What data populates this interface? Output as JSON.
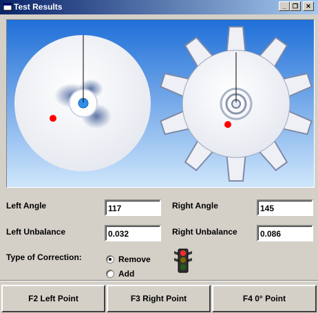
{
  "window": {
    "title": "Test Results",
    "controls": {
      "minimize": "_",
      "restore": "❐",
      "close": "✕"
    }
  },
  "readings": {
    "left_angle": {
      "label": "Left Angle",
      "value": "117"
    },
    "right_angle": {
      "label": "Right Angle",
      "value": "145"
    },
    "left_unbalance": {
      "label": "Left Unbalance",
      "value": "0.032"
    },
    "right_unbalance": {
      "label": "Right Unbalance",
      "value": "0.086"
    }
  },
  "correction": {
    "label": "Type of Correction:",
    "options": [
      "Remove",
      "Add"
    ],
    "selected": "Remove"
  },
  "traffic_light": {
    "active": "red"
  },
  "buttons": {
    "left_point": "F2 Left Point",
    "right_point": "F3 Right Point",
    "zero_point": "F4 0° Point"
  },
  "colors": {
    "marker": "#ff0000",
    "sky_top": "#1f6fd8",
    "sky_bottom": "#cfe6fb"
  }
}
